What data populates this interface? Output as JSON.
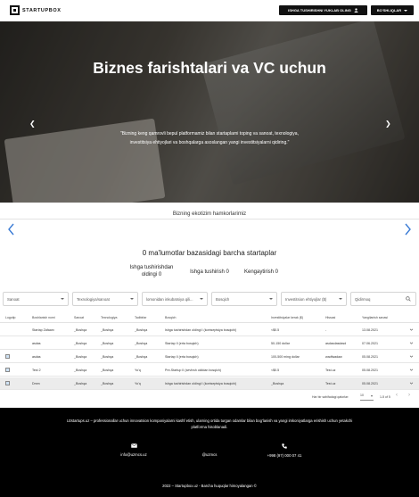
{
  "header": {
    "logo_text": "STARTUPBOX",
    "upload_button": "ISHGA TUSHIRISHNI YUKLAB OLING",
    "sections_button": "BO'SHLIQLAR"
  },
  "hero": {
    "title": "Biznes farishtalari va VC uchun",
    "subtitle": "\"Bizning keng qamrovli bepul platformamiz bilan startaplarni toping va sanoat, texnologiya, investitsiya ehtiyojlari va boshqalarga asoslangan yangi investitsiyalarni qidiring.\""
  },
  "partners": {
    "title": "Bizning ekotizim hamkorlarimiz"
  },
  "database": {
    "title": "0 ma'lumotlar bazasidagi barcha startaplar",
    "stages": [
      {
        "label": "Ishga tushirishdan oldingi 0"
      },
      {
        "label": "Ishga tushirish 0"
      },
      {
        "label": "Kengaytirish 0"
      }
    ]
  },
  "filters": {
    "industry": "Sanoat",
    "technology": "Texnologiya/sanoat",
    "stage": "lomonidan inkubatsiya qili...",
    "stage_label": "Bosqich",
    "investment": "Investitsion ehtiyojlar ($)",
    "search_placeholder": "Qidirmoq"
  },
  "table": {
    "headers": [
      "Logotip",
      "Boshlanish nomi",
      "Sanoat",
      "Texnologiya",
      "Tadbirlar",
      "Bosqich",
      "Investitsiyalar kerak ($)",
      "Hissasi",
      "Yangilanish sanasi"
    ],
    "rows": [
      {
        "has_logo": false,
        "cells": [
          "Startap Zafaarx",
          "_Boshqa",
          "_Boshqa",
          "_Boshqa",
          "Ishga tushirishdan oldingi I (kontseptsiya bosqichi)",
          "<$0.5",
          "-",
          "13.08.2021"
        ]
      },
      {
        "has_logo": false,
        "cells": [
          "asdas",
          "_Boshqa",
          "_Boshqa",
          "_Boshqa",
          "Startap II (erta bosqich)",
          "50-150 dollar",
          "asdasdasdasd",
          "07.06.2021"
        ]
      },
      {
        "has_logo": true,
        "cells": [
          "asdas",
          "_Boshqa",
          "_Boshqa",
          "_Boshqa",
          "Startap II (erta bosqich)",
          "100-500 ming dollar",
          "wadfwadaw",
          "05.08.2021"
        ]
      },
      {
        "has_logo": true,
        "cells": [
          "Test 2",
          "_Boshqa",
          "_Boshqa",
          "Yo'q",
          "Pre-Startup II (sevfvsh oldidan bosqich)",
          "<$0.5",
          "Test.uz",
          "05.08.2021"
        ]
      },
      {
        "has_logo": true,
        "cells": [
          "Dmm",
          "_Boshqa",
          "_Boshqa",
          "Yo'q",
          "Ishga tushirishdan oldingi I (kontseptsiya bosqichi)",
          "_Boshqa",
          "Test.uz",
          "05.08.2021"
        ]
      }
    ],
    "pagination": {
      "rows_per_page_label": "Har bir sahifadagi qatorlar:",
      "rows_per_page": "10",
      "range": "1-5 of 5"
    }
  },
  "footer": {
    "description": "Uzstartups.uz – professionallar uchun innovatsion kompaniyalarni kashf etish, ularning ortida turgan odamlar bilan bog'lanish va yangi imkoniyatlarga erishish uchun yetakchi platforma hisoblanadi.",
    "email": "info@uzmcs.uz",
    "social": "@uzmcs",
    "phone": "+998 (97) 000 07 41",
    "copyright": "2022 – Startupbox.uz - Barcha huquqlar himoyalangan ©"
  }
}
